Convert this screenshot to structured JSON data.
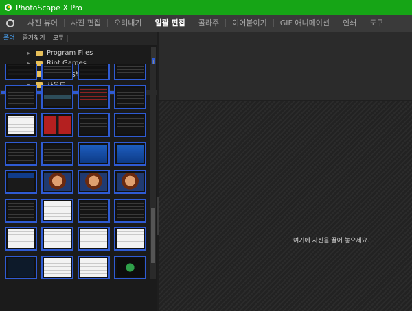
{
  "window": {
    "title": "PhotoScape X Pro"
  },
  "menu": {
    "tabs": [
      {
        "label": "사진 뷰어",
        "active": false
      },
      {
        "label": "사진 편집",
        "active": false
      },
      {
        "label": "오려내기",
        "active": false
      },
      {
        "label": "일괄 편집",
        "active": true
      },
      {
        "label": "콜라주",
        "active": false
      },
      {
        "label": "이어붙이기",
        "active": false
      },
      {
        "label": "GIF 애니메이션",
        "active": false
      },
      {
        "label": "인쇄",
        "active": false
      },
      {
        "label": "도구",
        "active": false
      }
    ]
  },
  "browser": {
    "subtabs": [
      "폴더",
      "즐겨찾기",
      "모두"
    ],
    "folders": [
      "Program Files",
      "Riot Games",
      "미니툴OS백업이미지",
      "사운드"
    ]
  },
  "thumbnails": {
    "count": 32,
    "styles": [
      "green-text",
      "dark-code",
      "green-text",
      "dark-code",
      "dark-code",
      "dark-ui",
      "red-table",
      "dark-code",
      "white-doc",
      "red-boxes",
      "dark-code",
      "dark-code",
      "dark-code",
      "dark-code",
      "blue-screen",
      "blue-screen",
      "blue-site",
      "portrait",
      "portrait",
      "portrait",
      "dark-code",
      "white-doc",
      "dark-code",
      "dark-code",
      "white-doc",
      "white-doc",
      "white-doc",
      "white-doc",
      "bandisoft",
      "white-doc",
      "white-doc",
      "green-logo"
    ]
  },
  "workspace": {
    "drop_message": "여기에 사진을 끌어 놓으세요."
  },
  "colors": {
    "titlebar": "#16a516",
    "thumb_border": "#2f5bd3",
    "active_subtab": "#4aa8ff"
  }
}
